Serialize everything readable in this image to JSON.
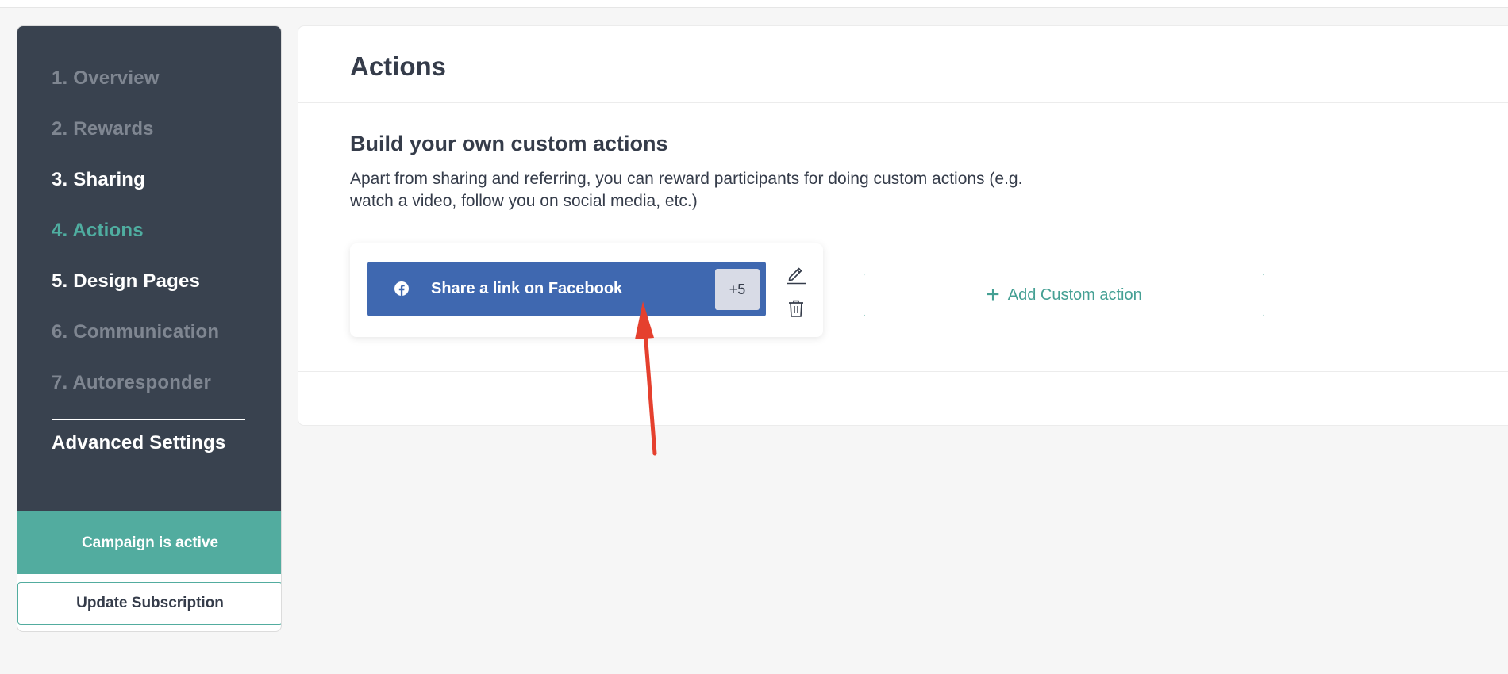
{
  "sidebar": {
    "items": [
      {
        "label": "1. Overview",
        "state": "muted"
      },
      {
        "label": "2. Rewards",
        "state": "muted"
      },
      {
        "label": "3. Sharing",
        "state": "white"
      },
      {
        "label": "4. Actions",
        "state": "active"
      },
      {
        "label": "5. Design Pages",
        "state": "white"
      },
      {
        "label": "6. Communication",
        "state": "muted"
      },
      {
        "label": "7. Autoresponder",
        "state": "muted"
      }
    ],
    "advanced_label": "Advanced Settings",
    "status_text": "Campaign is active",
    "update_button_label": "Update Subscription"
  },
  "main": {
    "title": "Actions",
    "section_title": "Build your own custom actions",
    "section_desc_line1": "Apart from sharing and referring, you can reward participants for doing custom actions (e.g.",
    "section_desc_line2": "watch a video, follow you on social media, etc.)",
    "action": {
      "label": "Share a link on Facebook",
      "points": "+5",
      "icon": "facebook-icon"
    },
    "add_custom_label": "Add Custom action"
  },
  "colors": {
    "sidebar_bg": "#39424f",
    "accent": "#52ac9f",
    "facebook": "#3f68b0",
    "annotation_arrow": "#e5402e"
  }
}
